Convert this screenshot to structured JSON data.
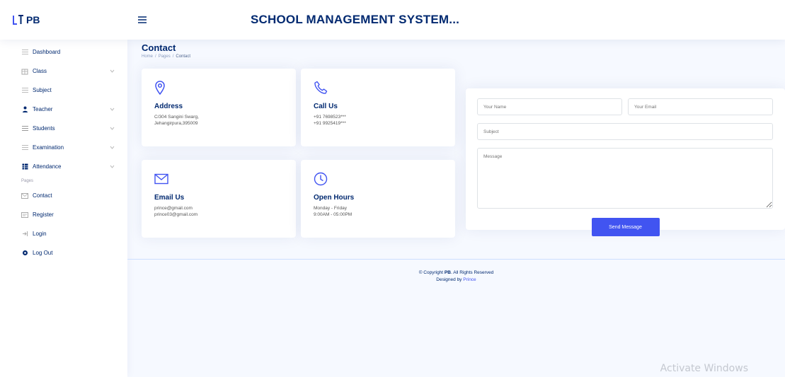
{
  "header": {
    "logo_text": "PB",
    "site_title": "SCHOOL MANAGEMENT SYSTEM..."
  },
  "sidebar": {
    "items": [
      {
        "label": "Dashboard",
        "icon": "grid-icon"
      },
      {
        "label": "Class",
        "icon": "building-icon"
      },
      {
        "label": "Subject",
        "icon": "menu-icon"
      },
      {
        "label": "Teacher",
        "icon": "person-icon"
      },
      {
        "label": "Students",
        "icon": "list-icon"
      },
      {
        "label": "Examination",
        "icon": "document-icon"
      },
      {
        "label": "Attendance",
        "icon": "table-icon"
      }
    ],
    "heading": "Pages",
    "page_items": [
      {
        "label": "Contact",
        "icon": "envelope-icon"
      },
      {
        "label": "Register",
        "icon": "card-icon"
      },
      {
        "label": "Login",
        "icon": "login-icon"
      },
      {
        "label": "Log Out",
        "icon": "gear-icon"
      }
    ]
  },
  "page": {
    "title": "Contact",
    "breadcrumb": [
      "Home",
      "Pages",
      "Contact"
    ]
  },
  "cards": {
    "address": {
      "title": "Address",
      "lines": [
        "C/304 Sangini Swarg,",
        "Jehangirpura,395009"
      ]
    },
    "call": {
      "title": "Call Us",
      "lines": [
        "+91 7698523***",
        "+91 9925419***"
      ]
    },
    "email": {
      "title": "Email Us",
      "lines": [
        "prince@gmail.com",
        "prince03@gmail.com"
      ]
    },
    "hours": {
      "title": "Open Hours",
      "lines": [
        "Monday - Friday",
        "9:00AM - 05:00PM"
      ]
    }
  },
  "form": {
    "name_placeholder": "Your Name",
    "email_placeholder": "Your Email",
    "subject_placeholder": "Subject",
    "message_placeholder": "Message",
    "send_label": "Send Message"
  },
  "footer": {
    "copyright_prefix": "© Copyright",
    "brand": "PB",
    "copyright_suffix": ". All Rights Reserved",
    "designed_prefix": "Designed by",
    "designer": "Prince"
  },
  "watermark": "Activate Windows",
  "colors": {
    "accent": "#4154f1",
    "navy": "#012970",
    "background": "#f6f9ff"
  }
}
